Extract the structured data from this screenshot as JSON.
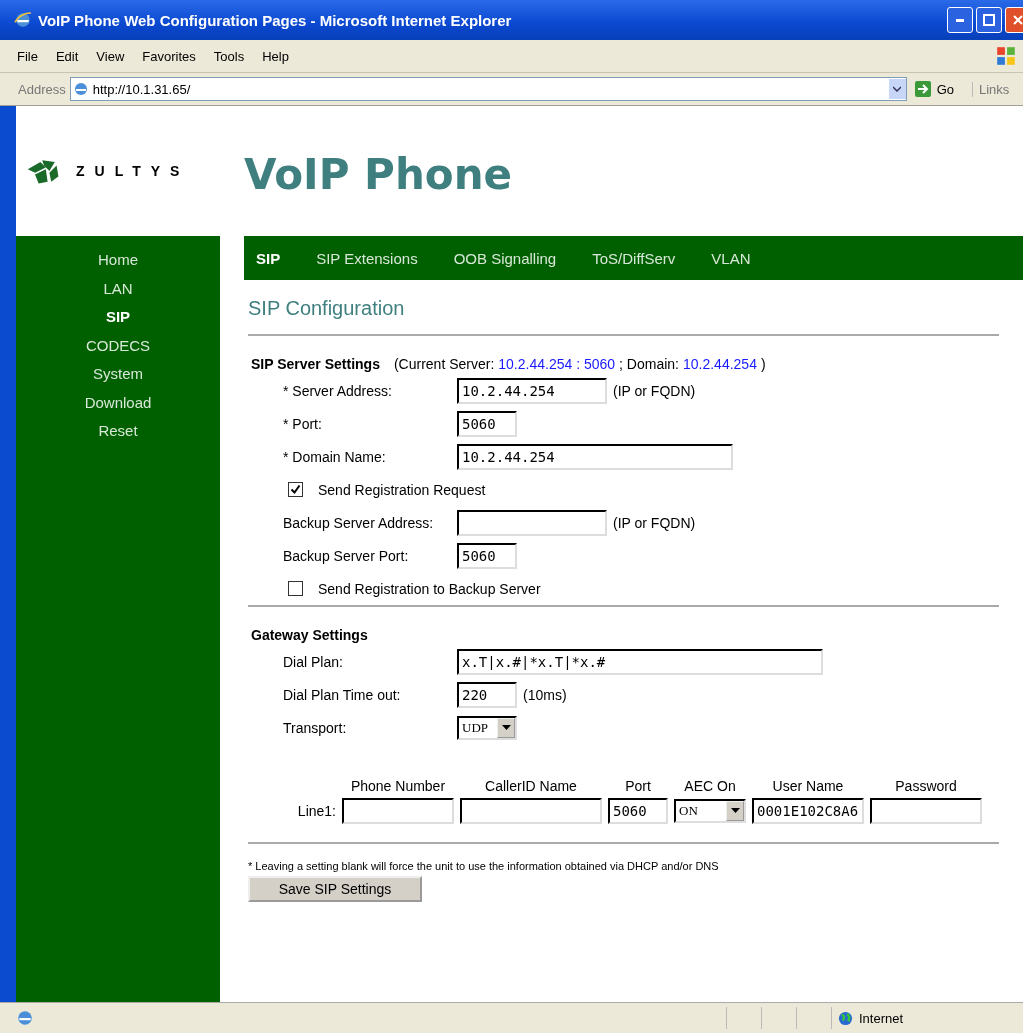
{
  "window": {
    "title": "VoIP Phone Web Configuration Pages - Microsoft Internet Explorer"
  },
  "menu": [
    "File",
    "Edit",
    "View",
    "Favorites",
    "Tools",
    "Help"
  ],
  "address": {
    "label": "Address",
    "value": "http://10.1.31.65/",
    "go": "Go",
    "links": "Links"
  },
  "logo": {
    "text": "ZULTYS"
  },
  "page_title": "VoIP Phone",
  "sidebar": {
    "items": [
      {
        "label": "Home",
        "selected": false
      },
      {
        "label": "LAN",
        "selected": false
      },
      {
        "label": "SIP",
        "selected": true
      },
      {
        "label": "CODECS",
        "selected": false
      },
      {
        "label": "System",
        "selected": false
      },
      {
        "label": "Download",
        "selected": false
      },
      {
        "label": "Reset",
        "selected": false
      }
    ]
  },
  "tabs": [
    {
      "label": "SIP",
      "selected": true
    },
    {
      "label": "SIP Extensions",
      "selected": false
    },
    {
      "label": "OOB Signalling",
      "selected": false
    },
    {
      "label": "ToS/DiffServ",
      "selected": false
    },
    {
      "label": "VLAN",
      "selected": false
    }
  ],
  "heading": "SIP Configuration",
  "server_settings": {
    "title": "SIP Server Settings",
    "note": [
      {
        "kind": "text",
        "text": "(Current Server:"
      },
      {
        "kind": "value",
        "text": "10.2.44.254 : 5060"
      },
      {
        "kind": "text",
        "text": "; Domain:"
      },
      {
        "kind": "value",
        "text": "10.2.44.254"
      },
      {
        "kind": "text",
        "text": ")"
      }
    ],
    "fields": [
      {
        "kind": "input",
        "label": "* Server Address:",
        "value": "10.2.44.254",
        "suffix": "(IP or FQDN)"
      },
      {
        "kind": "input",
        "label": "* Port:",
        "value": "5060"
      },
      {
        "kind": "input",
        "label": "* Domain Name:",
        "value": "10.2.44.254"
      },
      {
        "kind": "checkbox",
        "label": "Send Registration Request",
        "checked": true
      },
      {
        "kind": "input",
        "label": "Backup Server Address:",
        "suffix": "(IP or FQDN)"
      },
      {
        "kind": "input",
        "label": "Backup Server Port:",
        "value": "5060"
      },
      {
        "kind": "checkbox",
        "label": "Send Registration to Backup Server",
        "checked": false
      }
    ]
  },
  "gateway_settings": {
    "title": "Gateway Settings",
    "fields": [
      {
        "kind": "input",
        "label": "Dial Plan:",
        "value": "x.T|x.#|*x.T|*x.#"
      },
      {
        "kind": "input",
        "label": "Dial Plan Time out:",
        "value": "220",
        "suffix": "(10ms)"
      },
      {
        "kind": "select",
        "label": "Transport:",
        "value": "UDP"
      }
    ]
  },
  "lines": {
    "columns": [
      "Phone Number",
      "CallerID Name",
      "Port",
      "AEC On",
      "User Name",
      "Password"
    ],
    "rows": [
      {
        "label": "Line1:",
        "cells": [
          {
            "kind": "input"
          },
          {
            "kind": "input"
          },
          {
            "kind": "input",
            "value": "5060"
          },
          {
            "kind": "select",
            "value": "ON"
          },
          {
            "kind": "input",
            "value": "0001E102C8A6"
          },
          {
            "kind": "input"
          }
        ]
      }
    ]
  },
  "footnote": "* Leaving a setting blank will force the unit to use the information obtained via DHCP and/or DNS",
  "save_button": "Save SIP Settings",
  "status_bar": {
    "zone": "Internet"
  }
}
